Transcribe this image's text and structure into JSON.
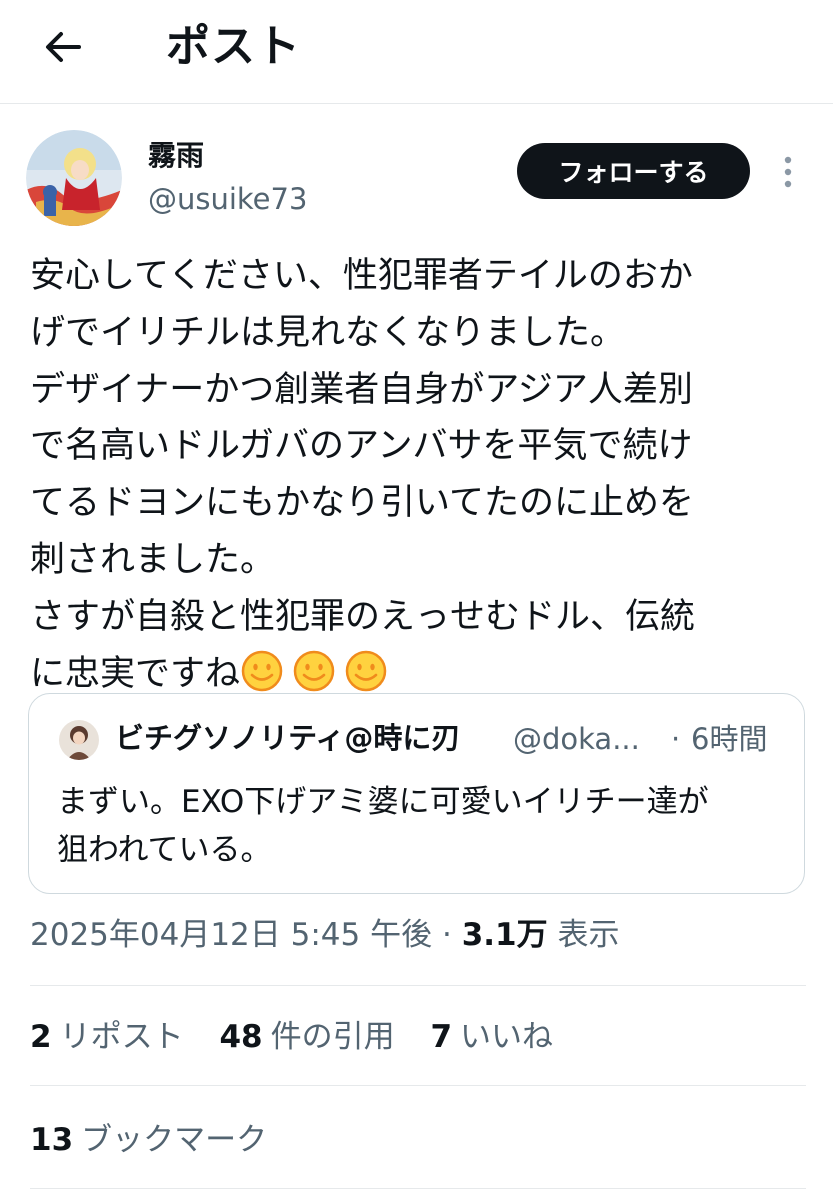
{
  "header": {
    "title": "ポスト",
    "back_icon": "arrow-left-icon"
  },
  "author": {
    "name": "霧雨",
    "handle": "@usuike73",
    "follow_label": "フォローする"
  },
  "tweet": {
    "lines": [
      "安心してください、性犯罪者テイルのおか",
      "げでイリチルは見れなくなりました。",
      "デザイナーかつ創業者自身がアジア人差別",
      "で名高いドルガバのアンバサを平気で続け",
      "てるドヨンにもかなり引いてたのに止めを",
      "刺されました。",
      "さすが自殺と性犯罪のえっせむドル、伝統",
      "に忠実ですね"
    ],
    "emoji": "smiling-face-emoji"
  },
  "quote": {
    "name": "ビチグソノリティ@時に刃",
    "handle": "@doka...",
    "separator": "·",
    "time": "6時間",
    "lines": [
      "まずい。EXO下げアミ婆に可愛いイリチー達が",
      "狙われている。"
    ]
  },
  "meta": {
    "datetime": "2025年04月12日 5:45 午後",
    "separator": "·",
    "views_count": "3.1万",
    "views_label": "表示"
  },
  "stats": {
    "reposts_count": "2",
    "reposts_label": "リポスト",
    "quotes_count": "48",
    "quotes_label": "件の引用",
    "likes_count": "7",
    "likes_label": "いいね",
    "bookmarks_count": "13",
    "bookmarks_label": "ブックマーク"
  },
  "colors": {
    "text_primary": "#0f1419",
    "text_secondary": "#536471",
    "divider": "#e6e9eb",
    "follow_button_bg": "#0f1419",
    "emoji_fill": "#ffd23f",
    "emoji_outline": "#f08b1c"
  }
}
